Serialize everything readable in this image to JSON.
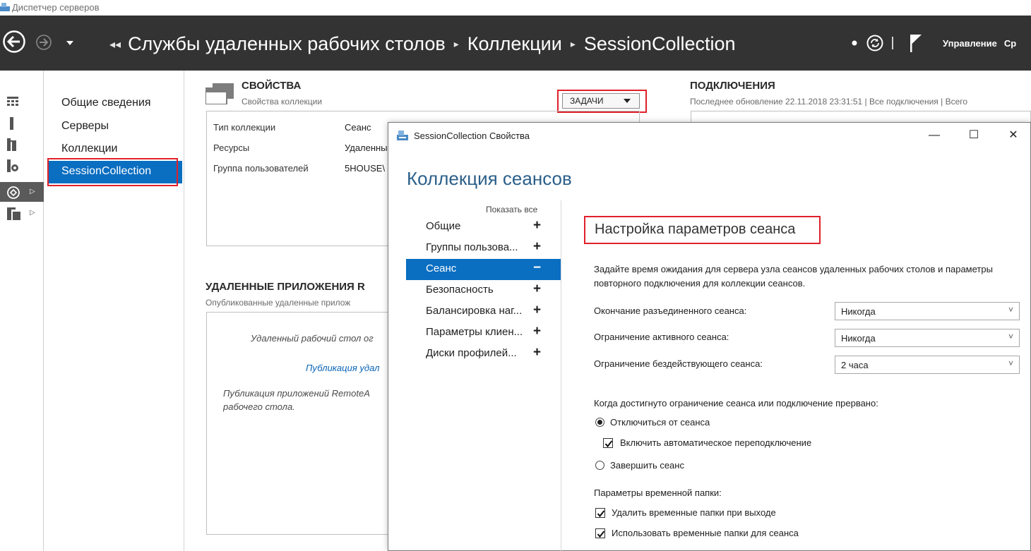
{
  "window": {
    "title": "Диспетчер серверов"
  },
  "nav": {
    "crumbs": [
      "Службы удаленных рабочих столов",
      "Коллекции",
      "SessionCollection"
    ],
    "manage_label": "Управление",
    "cut_label": "Ср"
  },
  "subnav": {
    "items": [
      "Общие сведения",
      "Серверы",
      "Коллекции",
      "SessionCollection"
    ]
  },
  "properties": {
    "title": "СВОЙСТВА",
    "subtitle": "Свойства коллекции",
    "tasks_label": "ЗАДАЧИ",
    "rows": [
      {
        "label": "Тип коллекции",
        "value": "Сеанс"
      },
      {
        "label": "Ресурсы",
        "value": "Удаленный"
      },
      {
        "label": "Группа пользователей",
        "value": "5HOUSE\\"
      }
    ]
  },
  "remote_apps": {
    "title": "УДАЛЕННЫЕ ПРИЛОЖЕНИЯ R",
    "subtitle": "Опубликованные удаленные прилож",
    "message1": "Удаленный рабочий стол ог",
    "link": "Публикация удал",
    "message2": "Публикация приложений RemoteA рабочего стола."
  },
  "connections": {
    "title": "ПОДКЛЮЧЕНИЯ",
    "subtitle": "Последнее обновление 22.11.2018 23:31:51 | Все подключения  | Всего"
  },
  "dialog": {
    "title": "SessionCollection Свойства",
    "heading": "Коллекция сеансов",
    "show_all": "Показать все",
    "nav": [
      {
        "label": "Общие",
        "sign": "+"
      },
      {
        "label": "Группы пользова...",
        "sign": "+"
      },
      {
        "label": "Сеанс",
        "sign": "−"
      },
      {
        "label": "Безопасность",
        "sign": "+"
      },
      {
        "label": "Балансировка наг...",
        "sign": "+"
      },
      {
        "label": "Параметры клиен...",
        "sign": "+"
      },
      {
        "label": "Диски профилей...",
        "sign": "+"
      }
    ],
    "section_title": "Настройка параметров сеанса",
    "description": "Задайте время ожидания для сервера узла сеансов удаленных рабочих столов и параметры повторного подключения для коллекции сеансов.",
    "fields": [
      {
        "label": "Окончание разъединенного сеанса:",
        "value": "Никогда"
      },
      {
        "label": "Ограничение активного сеанса:",
        "value": "Никогда"
      },
      {
        "label": "Ограничение бездействующего сеанса:",
        "value": "2 часа"
      }
    ],
    "limit_prompt": "Когда достигнуто ограничение сеанса или подключение прервано:",
    "radio_disconnect": "Отключиться от сеанса",
    "check_reconnect": "Включить автоматическое переподключение",
    "radio_end": "Завершить сеанс",
    "temp_title": "Параметры временной папки:",
    "check_delete_temp": "Удалить временные папки при выходе",
    "check_use_temp": "Использовать временные папки для сеанса"
  },
  "colors": {
    "accent": "#0a6ec1",
    "navbar": "#333333",
    "highlight": "#e0202a"
  }
}
